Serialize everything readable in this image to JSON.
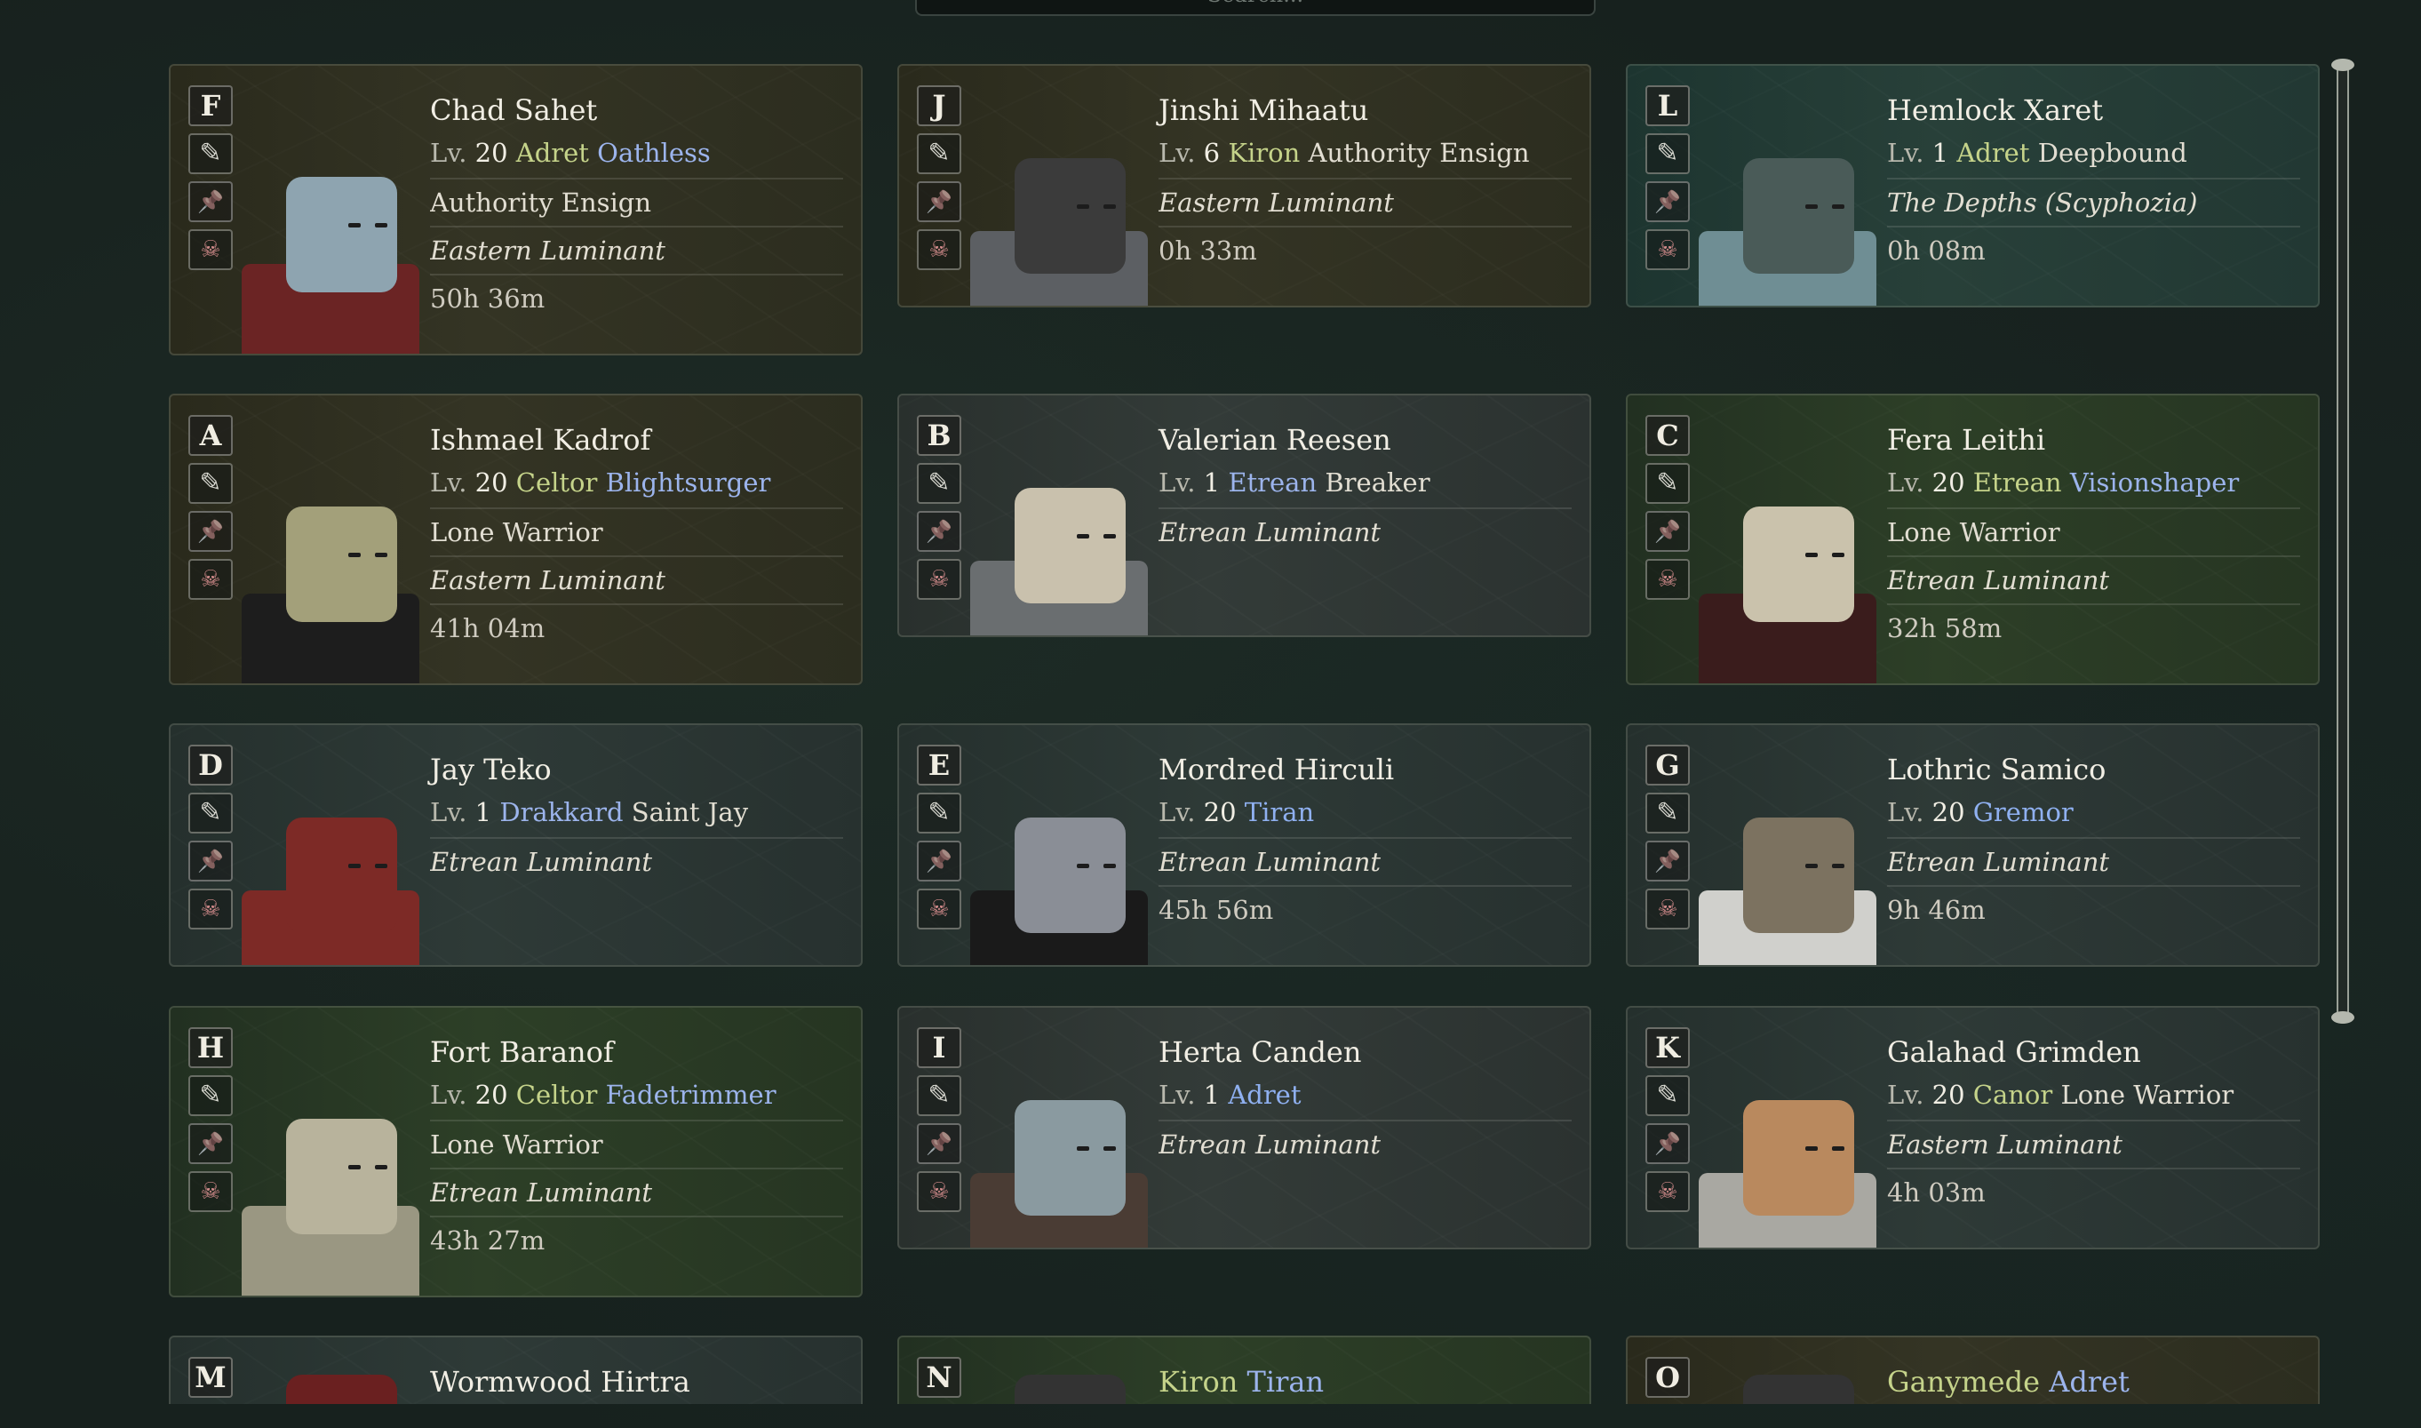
{
  "search": {
    "placeholder": "Search..."
  },
  "cards": [
    {
      "slot": "F",
      "name": "Chad Sahet",
      "lv_label": "Lv.",
      "level": "20",
      "race": "Adret",
      "race_color": "y",
      "title": "Oathless",
      "title_color": "b",
      "lines": [
        "Authority Ensign",
        "Eastern Luminant",
        "50h 36m"
      ],
      "theme": "olive",
      "skin": "#8ea4b0",
      "outfit": "#6b2424"
    },
    {
      "slot": "J",
      "name": "Jinshi Mihaatu",
      "lv_label": "Lv.",
      "level": "6",
      "race": "Kiron",
      "race_color": "y",
      "title": "Authority Ensign",
      "title_color": "w",
      "lines": [
        "Eastern Luminant",
        "0h 33m"
      ],
      "theme": "olive",
      "skin": "#3b3b3b",
      "outfit": "#5c5f63"
    },
    {
      "slot": "L",
      "name": "Hemlock Xaret",
      "lv_label": "Lv.",
      "level": "1",
      "race": "Adret",
      "race_color": "y",
      "title": "Deepbound",
      "title_color": "w",
      "lines": [
        "The Depths (Scyphozia)",
        "0h 08m"
      ],
      "theme": "teal",
      "skin": "#4a5b58",
      "outfit": "#6f8e94"
    },
    {
      "slot": "A",
      "name": "Ishmael Kadrof",
      "lv_label": "Lv.",
      "level": "20",
      "race": "Celtor",
      "race_color": "y",
      "title": "Blightsurger",
      "title_color": "b",
      "lines": [
        "Lone Warrior",
        "Eastern Luminant",
        "41h 04m"
      ],
      "theme": "olive",
      "skin": "#a3a07a",
      "outfit": "#1d1d1d"
    },
    {
      "slot": "B",
      "name": "Valerian Reesen",
      "lv_label": "Lv.",
      "level": "1",
      "race": "Etrean",
      "race_color": "b",
      "title": "Breaker",
      "title_color": "w",
      "lines": [
        "Etrean Luminant"
      ],
      "theme": "grey",
      "skin": "#c9c1ad",
      "outfit": "#6a6e70"
    },
    {
      "slot": "C",
      "name": "Fera Leithi",
      "lv_label": "Lv.",
      "level": "20",
      "race": "Etrean",
      "race_color": "y",
      "title": "Visionshaper",
      "title_color": "b",
      "lines": [
        "Lone Warrior",
        "Etrean Luminant",
        "32h 58m"
      ],
      "theme": "green",
      "skin": "#cac2ac",
      "outfit": "#3a1c1c"
    },
    {
      "slot": "D",
      "name": "Jay Teko",
      "lv_label": "Lv.",
      "level": "1",
      "race": "Drakkard",
      "race_color": "b",
      "title": "Saint Jay",
      "title_color": "w",
      "lines": [
        "Etrean Luminant"
      ],
      "theme": "slate",
      "skin": "#7d2a26",
      "outfit": "#7d2a26"
    },
    {
      "slot": "E",
      "name": "Mordred Hirculi",
      "lv_label": "Lv.",
      "level": "20",
      "race": "Tiran",
      "race_color": "bb",
      "title": "",
      "title_color": "w",
      "lines": [
        "Etrean Luminant",
        "45h 56m"
      ],
      "theme": "slate",
      "skin": "#8a8e96",
      "outfit": "#1a1a1a"
    },
    {
      "slot": "G",
      "name": "Lothric Samico",
      "lv_label": "Lv.",
      "level": "20",
      "race": "Gremor",
      "race_color": "bb",
      "title": "",
      "title_color": "w",
      "lines": [
        "Etrean Luminant",
        "9h 46m"
      ],
      "theme": "slate",
      "skin": "#7c7260",
      "outfit": "#d0d0cc"
    },
    {
      "slot": "H",
      "name": "Fort Baranof",
      "lv_label": "Lv.",
      "level": "20",
      "race": "Celtor",
      "race_color": "y",
      "title": "Fadetrimmer",
      "title_color": "b",
      "lines": [
        "Lone Warrior",
        "Etrean Luminant",
        "43h 27m"
      ],
      "theme": "green",
      "skin": "#b8b39c",
      "outfit": "#9a9782"
    },
    {
      "slot": "I",
      "name": "Herta Canden",
      "lv_label": "Lv.",
      "level": "1",
      "race": "Adret",
      "race_color": "bb",
      "title": "",
      "title_color": "w",
      "lines": [
        "Etrean Luminant"
      ],
      "theme": "grey",
      "skin": "#8a9aa0",
      "outfit": "#4a3c34"
    },
    {
      "slot": "K",
      "name": "Galahad Grimden",
      "lv_label": "Lv.",
      "level": "20",
      "race": "Canor",
      "race_color": "y",
      "title": "Lone Warrior",
      "title_color": "w",
      "lines": [
        "Eastern Luminant",
        "4h 03m"
      ],
      "theme": "slate",
      "skin": "#b9895e",
      "outfit": "#a9a8a2"
    },
    {
      "slot": "M",
      "name": "Wormwood Hirtra",
      "lv_label": "",
      "level": "",
      "race": "",
      "race_color": "y",
      "title": "",
      "title_color": "w",
      "lines": [],
      "theme": "slate",
      "skin": "#6a2020",
      "outfit": "#333"
    },
    {
      "slot": "N",
      "name": "",
      "lv_label": "",
      "level": "",
      "race": "Kiron",
      "race_color": "y",
      "title": "Tiran",
      "title_color": "b",
      "lines": [],
      "theme": "green",
      "skin": "#333",
      "outfit": "#333"
    },
    {
      "slot": "O",
      "name": "",
      "lv_label": "",
      "level": "",
      "race": "Ganymede",
      "race_color": "y",
      "title": "Adret",
      "title_color": "b",
      "lines": [],
      "theme": "olive",
      "skin": "#333",
      "outfit": "#333"
    }
  ],
  "colors": {
    "accent_yellow": "#c5d38a",
    "accent_blue": "#9cb4ec",
    "background": "#17211e"
  },
  "icons": {
    "edit": "pencil-icon",
    "pin": "pin-icon",
    "delete": "skull-icon"
  }
}
